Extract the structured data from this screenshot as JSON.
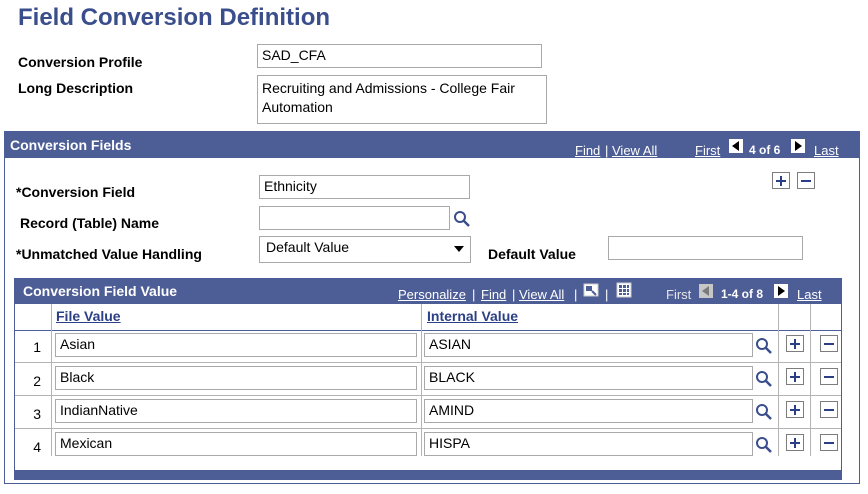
{
  "page": {
    "title": "Field Conversion Definition"
  },
  "profile": {
    "conversion_profile_label": "Conversion Profile",
    "conversion_profile_value": "SAD_CFA",
    "long_description_label": "Long Description",
    "long_description_value": "Recruiting and Admissions - College Fair Automation"
  },
  "conversion_fields": {
    "header": "Conversion Fields",
    "find": "Find",
    "view_all": "View All",
    "first": "First",
    "page_indicator": "4 of 6",
    "last": "Last",
    "conversion_field_label": "*Conversion Field",
    "conversion_field_value": "Ethnicity",
    "record_name_label": "Record (Table) Name",
    "record_name_value": "",
    "unmatched_label": "*Unmatched Value Handling",
    "unmatched_value": "Default Value",
    "default_value_label": "Default Value",
    "default_value_value": ""
  },
  "value_grid": {
    "header": "Conversion Field Value",
    "personalize": "Personalize",
    "find": "Find",
    "view_all": "View All",
    "first": "First",
    "page_indicator": "1-4 of 8",
    "last": "Last",
    "columns": [
      "File Value",
      "Internal Value"
    ],
    "rows": [
      {
        "num": "1",
        "file_value": "Asian",
        "internal_value": "ASIAN"
      },
      {
        "num": "2",
        "file_value": "Black",
        "internal_value": "BLACK"
      },
      {
        "num": "3",
        "file_value": "IndianNative",
        "internal_value": "AMIND"
      },
      {
        "num": "4",
        "file_value": "Mexican",
        "internal_value": "HISPA"
      }
    ]
  },
  "colors": {
    "title": "#3a4e8c",
    "header_bar": "#4d5d96",
    "link": "#2b3f86"
  }
}
